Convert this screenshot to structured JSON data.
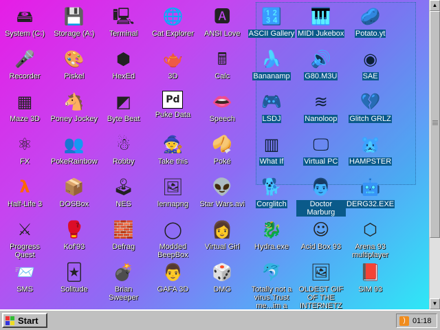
{
  "desktop": {
    "icons": [
      {
        "label": "System (C:)",
        "glyph": "🖴",
        "name": "system-drive-icon"
      },
      {
        "label": "Storage (A:)",
        "glyph": "💾",
        "name": "floppy-drive-icon"
      },
      {
        "label": "Terminal",
        "glyph": "🖳",
        "name": "terminal-icon"
      },
      {
        "label": "Cat Explorer",
        "glyph": "🌐",
        "name": "cat-explorer-icon"
      },
      {
        "label": "ANSI Love",
        "glyph": "🅰",
        "name": "ansi-love-icon"
      },
      {
        "label": "ASCII Gallery",
        "glyph": "🔢",
        "name": "ascii-gallery-icon",
        "selected": true
      },
      {
        "label": "MIDI Jukebox",
        "glyph": "🎹",
        "name": "midi-jukebox-icon",
        "selected": true
      },
      {
        "label": "Potato.yt",
        "glyph": "🥔",
        "name": "potato-icon",
        "selected": true
      },
      {
        "label": "Recorder",
        "glyph": "🎤",
        "name": "recorder-icon"
      },
      {
        "label": "Piskel",
        "glyph": "🎨",
        "name": "piskel-icon"
      },
      {
        "label": "HexEd",
        "glyph": "⬢",
        "name": "hexed-icon"
      },
      {
        "label": "3D",
        "glyph": "🫖",
        "name": "teapot-3d-icon"
      },
      {
        "label": "Calc",
        "glyph": "🖩",
        "name": "calculator-icon"
      },
      {
        "label": "Bananamp",
        "glyph": "🍌",
        "name": "bananamp-icon",
        "selected": true
      },
      {
        "label": "G80.M3U",
        "glyph": "🔊",
        "name": "playlist-icon",
        "selected": true
      },
      {
        "label": "SAE",
        "glyph": "◉",
        "name": "sae-icon",
        "selected": true
      },
      {
        "label": "Maze 3D",
        "glyph": "▦",
        "name": "maze-icon"
      },
      {
        "label": "Poney Jockey",
        "glyph": "🐴",
        "name": "pony-icon"
      },
      {
        "label": "Byte Beat",
        "glyph": "◩",
        "name": "byte-beat-icon"
      },
      {
        "label": "Puke Data",
        "glyph": "Pd",
        "name": "pure-data-icon"
      },
      {
        "label": "Speech",
        "glyph": "👄",
        "name": "speech-icon"
      },
      {
        "label": "LSDJ",
        "glyph": "🎮",
        "name": "lsdj-icon",
        "selected": true
      },
      {
        "label": "Nanoloop",
        "glyph": "≋",
        "name": "nanoloop-icon",
        "selected": true
      },
      {
        "label": "Glitch GRLZ",
        "glyph": "💔",
        "name": "glitch-icon",
        "selected": true
      },
      {
        "label": "FX",
        "glyph": "⚛",
        "name": "fx-icon"
      },
      {
        "label": "PokeRainbow",
        "glyph": "👥",
        "name": "pokerainbow-icon"
      },
      {
        "label": "Robby",
        "glyph": "☃",
        "name": "robby-icon"
      },
      {
        "label": "Take this",
        "glyph": "🧙",
        "name": "take-this-icon"
      },
      {
        "label": "Poké",
        "glyph": "🥠",
        "name": "poke-icon"
      },
      {
        "label": "What If",
        "glyph": "▥",
        "name": "what-if-icon",
        "selected": true
      },
      {
        "label": "Virtual PC",
        "glyph": "🖵",
        "name": "virtual-pc-icon",
        "selected": true
      },
      {
        "label": "HAMPSTER",
        "glyph": "🐹",
        "name": "hampster-icon",
        "selected": true
      },
      {
        "label": "Half-Life 3",
        "glyph": "λ",
        "name": "half-life-icon"
      },
      {
        "label": "DOSBox",
        "glyph": "📦",
        "name": "dosbox-icon"
      },
      {
        "label": "NES",
        "glyph": "🕹",
        "name": "nes-icon"
      },
      {
        "label": "lennapng",
        "glyph": "🖼",
        "name": "lenna-png-icon"
      },
      {
        "label": "Star Wars.avi",
        "glyph": "👽",
        "name": "star-wars-icon"
      },
      {
        "label": "Corglitch",
        "glyph": "🐕",
        "name": "corglitch-icon",
        "selected": true
      },
      {
        "label": "Doctor Marburg",
        "glyph": "👨",
        "name": "doctor-marburg-icon",
        "selected": true
      },
      {
        "label": "DERG32.EXE",
        "glyph": "🤖",
        "name": "derg32-icon",
        "selected": true
      },
      {
        "label": "Progress Quest",
        "glyph": "⚔",
        "name": "progress-quest-icon"
      },
      {
        "label": "Kof'93",
        "glyph": "🥊",
        "name": "kof93-icon"
      },
      {
        "label": "Defrag",
        "glyph": "🧱",
        "name": "defrag-icon"
      },
      {
        "label": "Modded BeepBox",
        "glyph": "◯",
        "name": "beepbox-icon"
      },
      {
        "label": "Virtual Girl",
        "glyph": "👩",
        "name": "virtual-girl-icon"
      },
      {
        "label": "Hydra.exe",
        "glyph": "🐉",
        "name": "hydra-icon"
      },
      {
        "label": "Acid Box 93",
        "glyph": "☺",
        "name": "acid-box-icon"
      },
      {
        "label": "Arena 93 multiplayer",
        "glyph": "⬡",
        "name": "arena-icon"
      },
      {
        "label": "SMS",
        "glyph": "📨",
        "name": "sms-icon"
      },
      {
        "label": "Solitude",
        "glyph": "🃏",
        "name": "solitude-icon"
      },
      {
        "label": "Brian Sweeper",
        "glyph": "💣",
        "name": "brian-sweeper-icon"
      },
      {
        "label": "GAFA 3D",
        "glyph": "👨",
        "name": "gafa-3d-icon"
      },
      {
        "label": "DMG",
        "glyph": "🎲",
        "name": "dmg-icon"
      },
      {
        "label": "Totally not a virus.Trust me...im a",
        "glyph": "🐬",
        "name": "not-a-virus-icon"
      },
      {
        "label": "OLDEST GIF OF THE INTERNETZ",
        "glyph": "🖼",
        "name": "oldest-gif-icon"
      },
      {
        "label": "SIM 93",
        "glyph": "📕",
        "name": "sim93-icon"
      }
    ]
  },
  "taskbar": {
    "start_label": "Start",
    "clock": "01:18",
    "tray_icon": "rss-icon"
  },
  "scrollbar": {
    "up_glyph": "▲",
    "down_glyph": "▼"
  }
}
